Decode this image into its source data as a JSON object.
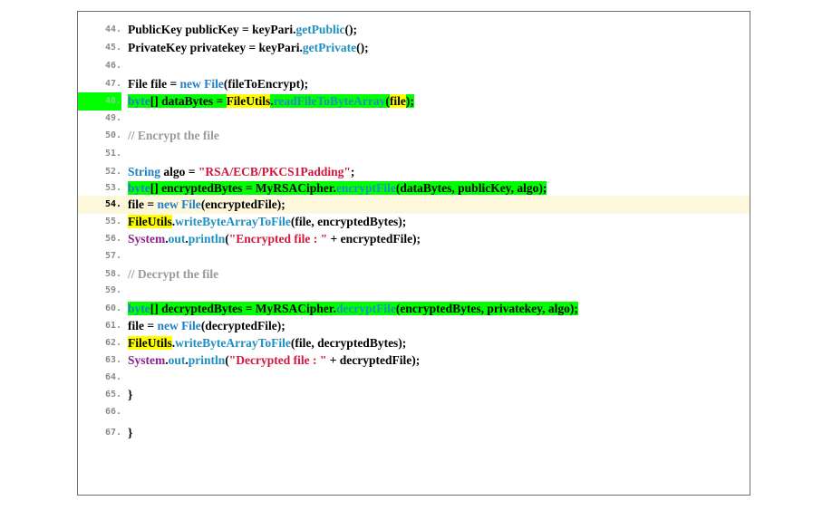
{
  "editor": {
    "lines": [
      {
        "num": "44.",
        "segments": [
          [
            "PublicKey publicKey = keyPari.",
            ""
          ],
          [
            "getPublic",
            "mth"
          ],
          [
            "();",
            ""
          ]
        ]
      },
      {
        "num": "45.",
        "segments": [
          [
            "PrivateKey privatekey = keyPari.",
            ""
          ],
          [
            "getPrivate",
            "mth"
          ],
          [
            "();",
            ""
          ]
        ]
      },
      {
        "num": "46.",
        "segments": []
      },
      {
        "num": "47.",
        "segments": [
          [
            "File file = ",
            ""
          ],
          [
            "new",
            "kw"
          ],
          [
            " ",
            ""
          ],
          [
            "File",
            "kw"
          ],
          [
            "(fileToEncrypt);",
            ""
          ]
        ]
      },
      {
        "num": "48.",
        "hl_num": true,
        "segments": [
          [
            "byte",
            "kw hlg"
          ],
          [
            "[] dataBytes = ",
            "hlg"
          ],
          [
            "FileUtils",
            "hly"
          ],
          [
            ".",
            "hlg"
          ],
          [
            "readFileToByteArray",
            "mth hlg"
          ],
          [
            "(",
            "paren hlg"
          ],
          [
            "file",
            "hly"
          ],
          [
            ");",
            "hlg"
          ]
        ]
      },
      {
        "num": "49.",
        "segments": []
      },
      {
        "num": "50.",
        "segments": [
          [
            "// Encrypt the file",
            "cm"
          ]
        ]
      },
      {
        "num": "51.",
        "segments": []
      },
      {
        "num": "52.",
        "segments": [
          [
            "String",
            "kw"
          ],
          [
            " algo = ",
            ""
          ],
          [
            "\"RSA/ECB/PKCS1Padding\"",
            "str"
          ],
          [
            ";",
            ""
          ]
        ]
      },
      {
        "num": "53.",
        "segments": [
          [
            "byte",
            "kw hlg"
          ],
          [
            "[] encryptedBytes = MyRSACipher.",
            "hlg"
          ],
          [
            "encryptFile",
            "mth hlg"
          ],
          [
            "(",
            "paren hlg"
          ],
          [
            "dataBytes, publicKey, algo",
            "hlg"
          ],
          [
            ");",
            "hlg"
          ]
        ]
      },
      {
        "num": "54.",
        "current": true,
        "segments": [
          [
            "file = ",
            ""
          ],
          [
            "new",
            "kw"
          ],
          [
            " ",
            ""
          ],
          [
            "File",
            "kw"
          ],
          [
            "(encryptedFile);",
            ""
          ]
        ]
      },
      {
        "num": "55.",
        "segments": [
          [
            "FileUtils",
            "hly"
          ],
          [
            ".",
            ""
          ],
          [
            "writeByteArrayToFile",
            "mth"
          ],
          [
            "(file, encryptedBytes);",
            ""
          ]
        ]
      },
      {
        "num": "56.",
        "segments": [
          [
            "System",
            "sys"
          ],
          [
            ".",
            ""
          ],
          [
            "out",
            "mth"
          ],
          [
            ".",
            ""
          ],
          [
            "println",
            "mth"
          ],
          [
            "(",
            ""
          ],
          [
            "\"Encrypted file : \"",
            "str"
          ],
          [
            " + encryptedFile);",
            ""
          ]
        ]
      },
      {
        "num": "57.",
        "segments": []
      },
      {
        "num": "58.",
        "segments": [
          [
            "// Decrypt the file",
            "cm"
          ]
        ]
      },
      {
        "num": "59.",
        "segments": []
      },
      {
        "num": "60.",
        "segments": [
          [
            "byte",
            "kw hlg"
          ],
          [
            "[] decryptedBytes = MyRSACipher.",
            "hlg"
          ],
          [
            "decryptFile",
            "mth hlg"
          ],
          [
            "(",
            "paren hlg"
          ],
          [
            "encryptedBytes, privatekey, algo",
            "hlg"
          ],
          [
            ");",
            "hlg"
          ]
        ]
      },
      {
        "num": "61.",
        "segments": [
          [
            "file = ",
            ""
          ],
          [
            "new",
            "kw"
          ],
          [
            " ",
            ""
          ],
          [
            "File",
            "kw"
          ],
          [
            "(decryptedFile);",
            ""
          ]
        ]
      },
      {
        "num": "62.",
        "segments": [
          [
            "FileUtils",
            "hly"
          ],
          [
            ".",
            ""
          ],
          [
            "writeByteArrayToFile",
            "mth"
          ],
          [
            "(file, decryptedBytes);",
            ""
          ]
        ]
      },
      {
        "num": "63.",
        "segments": [
          [
            "System",
            "sys"
          ],
          [
            ".",
            ""
          ],
          [
            "out",
            "mth"
          ],
          [
            ".",
            ""
          ],
          [
            "println",
            "mth"
          ],
          [
            "(",
            ""
          ],
          [
            "\"Decrypted file : \"",
            "str"
          ],
          [
            " + decryptedFile);",
            ""
          ]
        ]
      },
      {
        "num": "64.",
        "segments": []
      },
      {
        "num": "65.",
        "segments": [
          [
            "}",
            ""
          ]
        ]
      },
      {
        "num": "66.",
        "segments": []
      },
      {
        "num": "67.",
        "segments": [
          [
            "}",
            ""
          ]
        ]
      }
    ]
  }
}
